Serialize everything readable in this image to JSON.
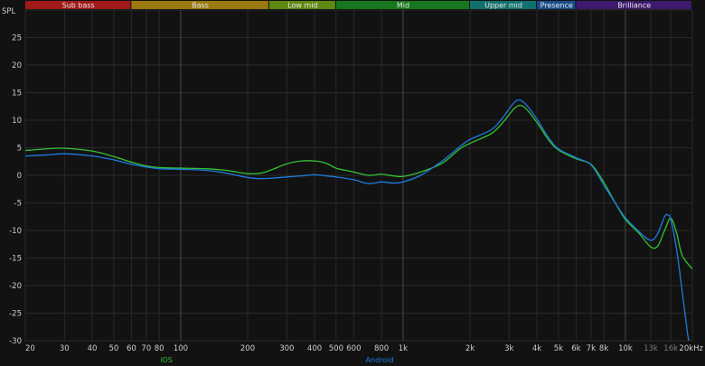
{
  "chart_data": {
    "type": "line",
    "ylabel": "SPL",
    "xscale": "log",
    "xlim": [
      20,
      20000
    ],
    "ylim": [
      -30,
      30
    ],
    "grid": true,
    "bands": [
      {
        "name": "Sub bass",
        "from": 20,
        "to": 60,
        "color": "#a11a1a"
      },
      {
        "name": "Bass",
        "from": 60,
        "to": 250,
        "color": "#9a7a10"
      },
      {
        "name": "Low mid",
        "from": 250,
        "to": 500,
        "color": "#5f8a12"
      },
      {
        "name": "Mid",
        "from": 500,
        "to": 2000,
        "color": "#17771f"
      },
      {
        "name": "Upper mid",
        "from": 2000,
        "to": 4000,
        "color": "#12706e"
      },
      {
        "name": "Presence",
        "from": 4000,
        "to": 6000,
        "color": "#1a4d8c"
      },
      {
        "name": "Brilliance",
        "from": 6000,
        "to": 20000,
        "color": "#3d1a6e"
      }
    ],
    "x_ticks": [
      {
        "v": 20,
        "label": "20"
      },
      {
        "v": 30,
        "label": "30"
      },
      {
        "v": 40,
        "label": "40"
      },
      {
        "v": 50,
        "label": "50"
      },
      {
        "v": 60,
        "label": "60"
      },
      {
        "v": 70,
        "label": "70"
      },
      {
        "v": 80,
        "label": "80"
      },
      {
        "v": 100,
        "label": "100"
      },
      {
        "v": 200,
        "label": "200"
      },
      {
        "v": 300,
        "label": "300"
      },
      {
        "v": 400,
        "label": "400"
      },
      {
        "v": 500,
        "label": "500"
      },
      {
        "v": 600,
        "label": "600"
      },
      {
        "v": 800,
        "label": "800"
      },
      {
        "v": 1000,
        "label": "1k"
      },
      {
        "v": 2000,
        "label": "2k"
      },
      {
        "v": 3000,
        "label": "3k"
      },
      {
        "v": 4000,
        "label": "4k"
      },
      {
        "v": 5000,
        "label": "5k"
      },
      {
        "v": 6000,
        "label": "6k"
      },
      {
        "v": 7000,
        "label": "7k"
      },
      {
        "v": 8000,
        "label": "8k"
      },
      {
        "v": 10000,
        "label": "10k"
      },
      {
        "v": 13000,
        "label": "13k"
      },
      {
        "v": 16000,
        "label": "16k"
      },
      {
        "v": 20000,
        "label": "20kHz"
      }
    ],
    "x_ticks_dim": [
      "13k",
      "16k"
    ],
    "x_major": [
      100,
      1000,
      10000
    ],
    "y_ticks": [
      25,
      20,
      15,
      10,
      5,
      0,
      -5,
      -10,
      -15,
      -20,
      -25,
      -30
    ],
    "series": [
      {
        "name": "iOS",
        "color": "#33c233",
        "points": [
          [
            20,
            4.5
          ],
          [
            25,
            4.8
          ],
          [
            30,
            4.9
          ],
          [
            40,
            4.4
          ],
          [
            50,
            3.4
          ],
          [
            60,
            2.4
          ],
          [
            70,
            1.7
          ],
          [
            80,
            1.4
          ],
          [
            100,
            1.3
          ],
          [
            130,
            1.2
          ],
          [
            160,
            0.9
          ],
          [
            200,
            0.3
          ],
          [
            230,
            0.4
          ],
          [
            260,
            1.1
          ],
          [
            300,
            2.1
          ],
          [
            350,
            2.6
          ],
          [
            400,
            2.6
          ],
          [
            450,
            2.2
          ],
          [
            500,
            1.3
          ],
          [
            600,
            0.6
          ],
          [
            700,
            0.0
          ],
          [
            800,
            0.2
          ],
          [
            900,
            -0.1
          ],
          [
            1000,
            -0.2
          ],
          [
            1200,
            0.6
          ],
          [
            1500,
            2.2
          ],
          [
            1800,
            4.8
          ],
          [
            2000,
            5.8
          ],
          [
            2500,
            7.6
          ],
          [
            2800,
            9.5
          ],
          [
            3200,
            12.3
          ],
          [
            3500,
            12.4
          ],
          [
            4000,
            9.6
          ],
          [
            4500,
            6.5
          ],
          [
            5000,
            4.6
          ],
          [
            6000,
            3.0
          ],
          [
            7000,
            2.0
          ],
          [
            8000,
            -1.3
          ],
          [
            9000,
            -5.0
          ],
          [
            10000,
            -8.0
          ],
          [
            11500,
            -10.5
          ],
          [
            13000,
            -13.0
          ],
          [
            14000,
            -12.8
          ],
          [
            15000,
            -10.0
          ],
          [
            16000,
            -7.8
          ],
          [
            17000,
            -10.5
          ],
          [
            18000,
            -14.5
          ],
          [
            20000,
            -17.0
          ]
        ]
      },
      {
        "name": "Android",
        "color": "#1e7be0",
        "points": [
          [
            20,
            3.5
          ],
          [
            25,
            3.7
          ],
          [
            30,
            3.9
          ],
          [
            40,
            3.5
          ],
          [
            50,
            2.8
          ],
          [
            60,
            2.0
          ],
          [
            70,
            1.5
          ],
          [
            80,
            1.2
          ],
          [
            100,
            1.1
          ],
          [
            130,
            0.9
          ],
          [
            160,
            0.4
          ],
          [
            200,
            -0.4
          ],
          [
            230,
            -0.6
          ],
          [
            260,
            -0.5
          ],
          [
            300,
            -0.3
          ],
          [
            350,
            -0.1
          ],
          [
            400,
            0.1
          ],
          [
            450,
            -0.1
          ],
          [
            500,
            -0.3
          ],
          [
            600,
            -0.8
          ],
          [
            700,
            -1.5
          ],
          [
            800,
            -1.2
          ],
          [
            900,
            -1.4
          ],
          [
            1000,
            -1.2
          ],
          [
            1200,
            0.0
          ],
          [
            1500,
            2.6
          ],
          [
            1800,
            5.2
          ],
          [
            2000,
            6.5
          ],
          [
            2500,
            8.3
          ],
          [
            2800,
            10.4
          ],
          [
            3200,
            13.4
          ],
          [
            3500,
            13.2
          ],
          [
            4000,
            10.2
          ],
          [
            4500,
            6.9
          ],
          [
            5000,
            4.8
          ],
          [
            6000,
            3.2
          ],
          [
            7000,
            1.9
          ],
          [
            8000,
            -1.8
          ],
          [
            9000,
            -5.0
          ],
          [
            10000,
            -7.7
          ],
          [
            11500,
            -10.2
          ],
          [
            13000,
            -11.8
          ],
          [
            14000,
            -10.5
          ],
          [
            15000,
            -7.5
          ],
          [
            15500,
            -7.2
          ],
          [
            16000,
            -8.0
          ],
          [
            17000,
            -13.5
          ],
          [
            18000,
            -21.0
          ],
          [
            19000,
            -28.5
          ],
          [
            19500,
            -31.0
          ]
        ]
      }
    ]
  }
}
